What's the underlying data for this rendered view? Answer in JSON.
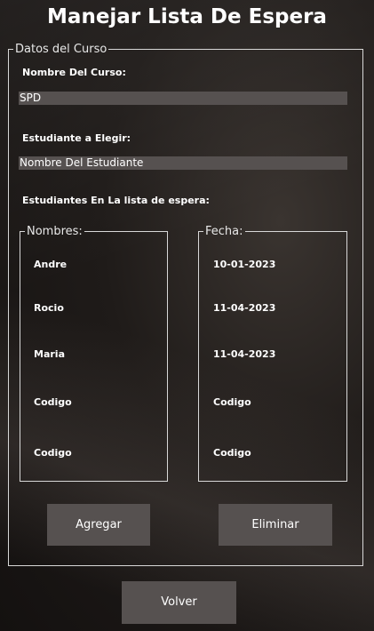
{
  "window": {
    "title": "Manejar Lista De Espera"
  },
  "course_group": {
    "legend": "Datos del Curso"
  },
  "course_name": {
    "label": "Nombre Del Curso:",
    "value": "SPD"
  },
  "student": {
    "label": "Estudiante a Elegir:",
    "value": "Nombre Del Estudiante"
  },
  "waitlist": {
    "label": "Estudiantes En La lista de espera:",
    "names_legend": "Nombres:",
    "dates_legend": "Fecha:",
    "names": [
      "Andre",
      "Rocio",
      "Maria",
      "Codigo",
      "Codigo"
    ],
    "dates": [
      "10-01-2023",
      "11-04-2023",
      "11-04-2023",
      "Codigo",
      "Codigo"
    ]
  },
  "buttons": {
    "add": "Agregar",
    "remove": "Eliminar",
    "back": "Volver"
  }
}
